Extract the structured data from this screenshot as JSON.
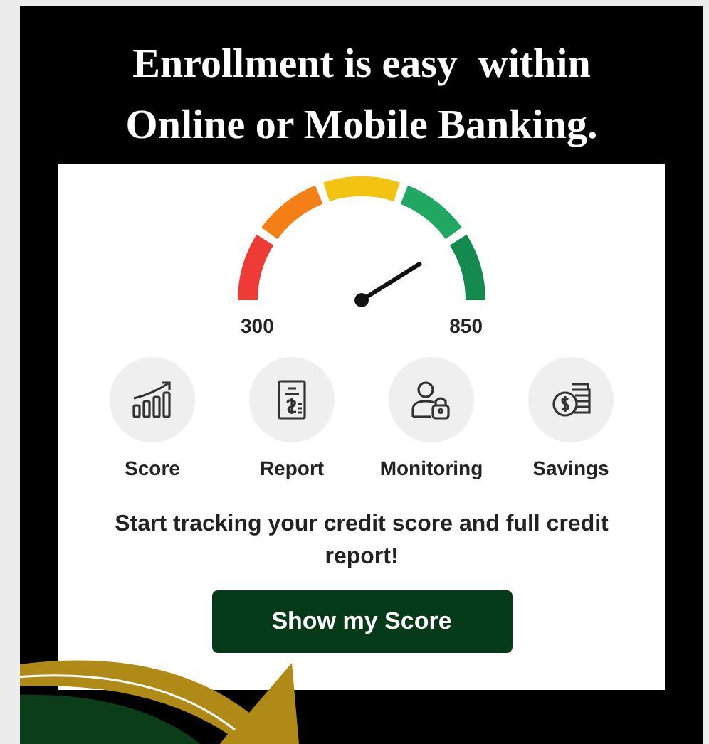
{
  "headline": "Enrollment is easy  within Online or Mobile Banking.",
  "gauge": {
    "min_label": "300",
    "max_label": "850"
  },
  "features": [
    {
      "kind": "score",
      "label": "Score"
    },
    {
      "kind": "report",
      "label": "Report"
    },
    {
      "kind": "monitoring",
      "label": "Monitoring"
    },
    {
      "kind": "savings",
      "label": "Savings"
    }
  ],
  "message": "Start tracking your credit score and full credit report!",
  "button": "Show my Score"
}
